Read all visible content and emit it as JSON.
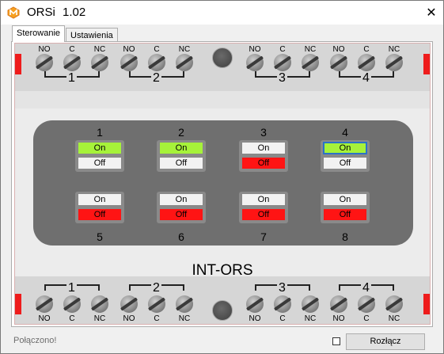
{
  "window": {
    "app_name": "ORSi",
    "version": "1.02",
    "close_glyph": "✕"
  },
  "tabs": [
    {
      "label": "Sterowanie",
      "active": true
    },
    {
      "label": "Ustawienia",
      "active": false
    }
  ],
  "device": {
    "name": "INT-ORS",
    "terminal_labels": [
      "NO",
      "C",
      "NC"
    ],
    "groups": [
      "1",
      "2",
      "3",
      "4"
    ],
    "bottom_groups": [
      "1",
      "2",
      "3",
      "4"
    ],
    "accent_red": "#ee1c1c"
  },
  "relays": [
    {
      "number": "1",
      "on_label": "On",
      "off_label": "Off",
      "state": "on"
    },
    {
      "number": "2",
      "on_label": "On",
      "off_label": "Off",
      "state": "on"
    },
    {
      "number": "3",
      "on_label": "On",
      "off_label": "Off",
      "state": "off"
    },
    {
      "number": "4",
      "on_label": "On",
      "off_label": "Off",
      "state": "on"
    },
    {
      "number": "5",
      "on_label": "On",
      "off_label": "Off",
      "state": "off"
    },
    {
      "number": "6",
      "on_label": "On",
      "off_label": "Off",
      "state": "off"
    },
    {
      "number": "7",
      "on_label": "On",
      "off_label": "Off",
      "state": "off"
    },
    {
      "number": "8",
      "on_label": "On",
      "off_label": "Off",
      "state": "off"
    }
  ],
  "colors": {
    "on_active": "#a6f23a",
    "off_active": "#ff1414",
    "inactive": "#f2f2f2"
  },
  "footer": {
    "status": "Połączono!",
    "disconnect_label": "Rozłącz"
  }
}
